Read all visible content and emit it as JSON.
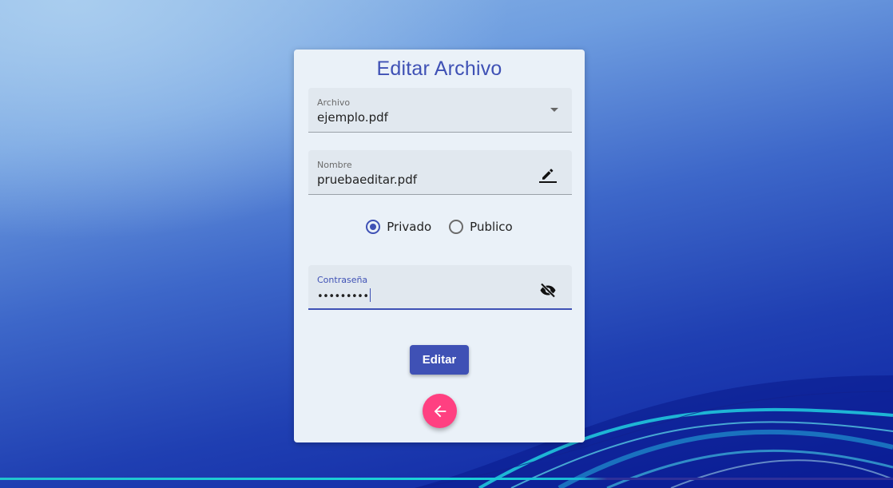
{
  "page": {
    "title": "Editar Archivo"
  },
  "form": {
    "archivo": {
      "label": "Archivo",
      "value": "ejemplo.pdf"
    },
    "nombre": {
      "label": "Nombre",
      "value": "pruebaeditar.pdf"
    },
    "visibility": {
      "options": [
        {
          "label": "Privado",
          "checked": true
        },
        {
          "label": "Publico",
          "checked": false
        }
      ]
    },
    "password": {
      "label": "Contraseña",
      "masked_value": "•••••••••"
    },
    "submit_label": "Editar"
  },
  "icons": {
    "archivo_field": "dropdown-arrow-icon",
    "nombre_field": "edit-pencil-icon",
    "password_field": "visibility-off-icon",
    "back_button": "arrow-left-icon"
  },
  "colors": {
    "primary": "#3f51b5",
    "accent": "#ff4081",
    "card_background": "#eaf1f8"
  }
}
